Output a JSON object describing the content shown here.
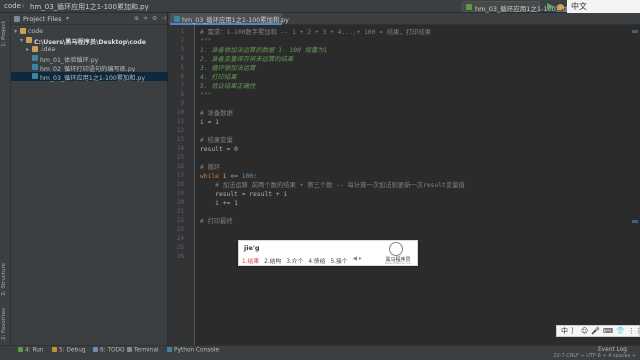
{
  "window": {
    "project_name": "code",
    "breadcrumb": "hm_03_循环应用1之1-100累加和.py",
    "run_config": "hm_03_循环应用1之1-100累加和",
    "ime_indicator": "中文"
  },
  "left_tabs": [
    "1: Project",
    "2: Structure",
    "2: Favorites"
  ],
  "project_panel": {
    "title": "Project Files",
    "tree": [
      {
        "label": "code",
        "level": 0,
        "type": "folder",
        "expanded": true
      },
      {
        "label": "C:\\Users\\黑马程序员\\Desktop\\code",
        "level": 1,
        "type": "folder",
        "expanded": true
      },
      {
        "label": ".idea",
        "level": 2,
        "type": "folder",
        "expanded": false
      },
      {
        "label": "hm_01_体验循环.py",
        "level": 2,
        "type": "py"
      },
      {
        "label": "hm_02_循环打印语句的编写练.py",
        "level": 2,
        "type": "py"
      },
      {
        "label": "hm_03_循环应用1之1-100累加和.py",
        "level": 2,
        "type": "py",
        "selected": true
      }
    ]
  },
  "editor": {
    "tab_label": "hm_03_循环应用1之1-100累加和.py",
    "lines": [
      {
        "n": "1",
        "kind": "comment",
        "text": "# 需求：1-100数字累加和 -- 1 + 2 + 3 + 4....+ 100 = 结果，打印结果"
      },
      {
        "n": "2",
        "kind": "doc",
        "text": "\"\"\""
      },
      {
        "n": "3",
        "kind": "doc",
        "text": "1. 准备做加法运算的数据 1- 100 增量为1"
      },
      {
        "n": "4",
        "kind": "doc",
        "text": "2. 准备变量保存将来运算的结果"
      },
      {
        "n": "5",
        "kind": "doc",
        "text": "3. 循环做加法运算"
      },
      {
        "n": "6",
        "kind": "doc",
        "text": "4. 打印结果"
      },
      {
        "n": "7",
        "kind": "doc",
        "text": "5. 验证结果正确性"
      },
      {
        "n": "8",
        "kind": "doc",
        "text": "\"\"\""
      },
      {
        "n": "9",
        "kind": "plain",
        "text": ""
      },
      {
        "n": "10",
        "kind": "comment",
        "text": "# 准备数据"
      },
      {
        "n": "11",
        "kind": "plain",
        "text": "i = 1"
      },
      {
        "n": "12",
        "kind": "plain",
        "text": ""
      },
      {
        "n": "13",
        "kind": "comment",
        "text": "# 结果变量"
      },
      {
        "n": "14",
        "kind": "plain",
        "text": "result = 0"
      },
      {
        "n": "15",
        "kind": "plain",
        "text": ""
      },
      {
        "n": "16",
        "kind": "comment",
        "text": "# 循环"
      },
      {
        "n": "17",
        "kind": "while",
        "text": "while i <= 100:"
      },
      {
        "n": "18",
        "kind": "comment",
        "text": "    # 加法运算 前两个数的结果 + 第三个数 -- 每计算一次加法则更新一次result变量值"
      },
      {
        "n": "19",
        "kind": "plain",
        "text": "    result = result + i"
      },
      {
        "n": "20",
        "kind": "plain",
        "text": "    i += 1"
      },
      {
        "n": "21",
        "kind": "plain",
        "text": ""
      },
      {
        "n": "22",
        "kind": "comment",
        "text": "# 打印最终"
      },
      {
        "n": "23",
        "kind": "plain",
        "text": ""
      },
      {
        "n": "24",
        "kind": "plain",
        "text": ""
      },
      {
        "n": "25",
        "kind": "plain",
        "text": ""
      },
      {
        "n": "26",
        "kind": "plain",
        "text": ""
      }
    ],
    "current_line": "22"
  },
  "ime_popup": {
    "pinyin": "jie'g",
    "candidates": [
      "1.结果",
      "2.结构",
      "3.介个",
      "4.债给",
      "5.接个"
    ],
    "nav": "◀ ▸",
    "brand": "黑马程序员",
    "brand_url": "www.itheima.com"
  },
  "ime_toolbar": [
    "中",
    "〕",
    "☺",
    "🎤",
    "⌨",
    "👕",
    "⋮⋮"
  ],
  "tool_windows": [
    {
      "label": "4: Run",
      "color": "#5a9e4b"
    },
    {
      "label": "5: Debug",
      "color": "#c0953a"
    },
    {
      "label": "6: TODO",
      "color": "#6a8eb3"
    },
    {
      "label": "Terminal",
      "color": "#888888"
    },
    {
      "label": "Python Console",
      "color": "#3e86a0"
    }
  ],
  "event_log": "Event Log",
  "status": "22:7  CRLF ÷  UTF-8 ÷  4 spaces ÷"
}
